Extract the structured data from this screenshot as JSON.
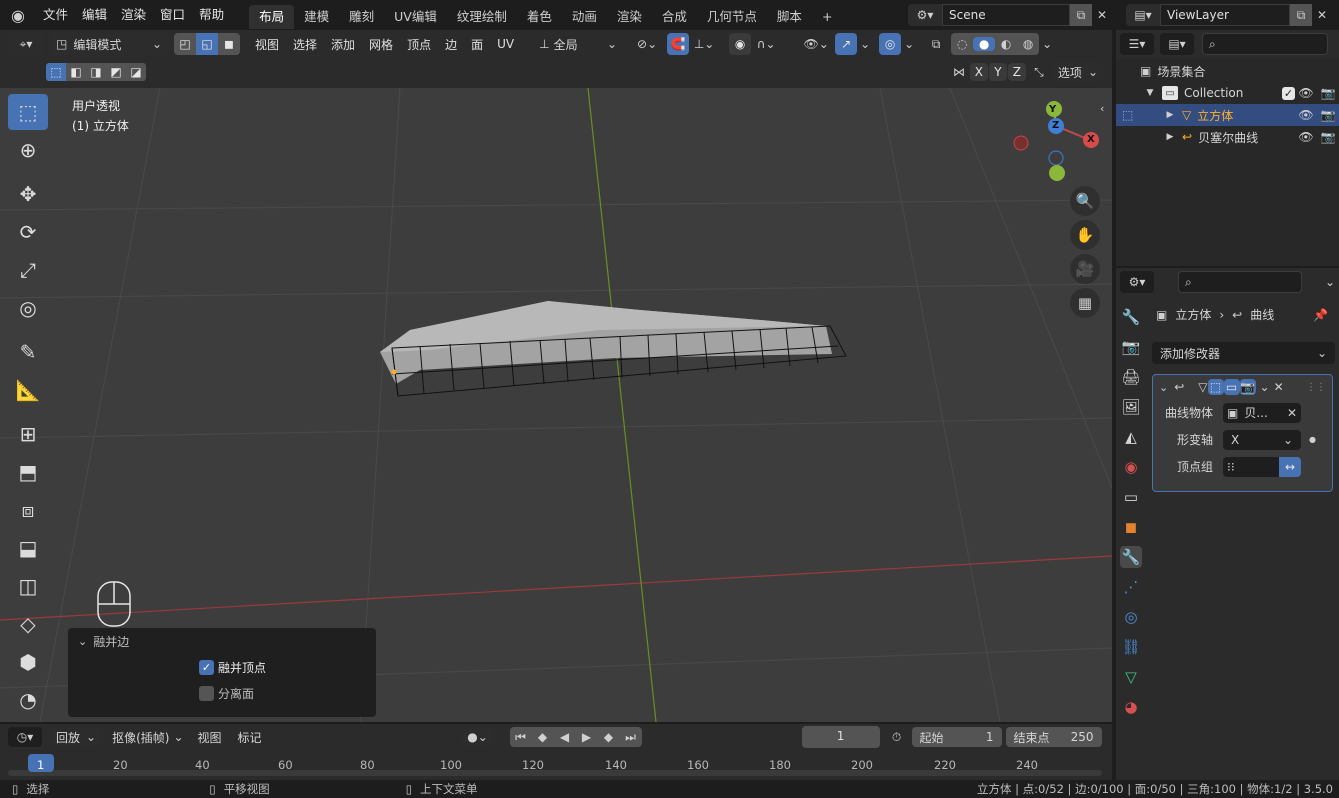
{
  "topbar": {
    "menus": [
      "文件",
      "编辑",
      "渲染",
      "窗口",
      "帮助"
    ],
    "workspaces": [
      "布局",
      "建模",
      "雕刻",
      "UV编辑",
      "纹理绘制",
      "着色",
      "动画",
      "渲染",
      "合成",
      "几何节点",
      "脚本"
    ],
    "active_workspace": "布局",
    "add_tab": "+",
    "scene": "Scene",
    "view_layer": "ViewLayer"
  },
  "viewport_header": {
    "mode": "编辑模式",
    "menus": [
      "视图",
      "选择",
      "添加",
      "网格",
      "顶点",
      "边",
      "面",
      "UV"
    ],
    "transform_orientation": "全局",
    "axes": [
      "X",
      "Y",
      "Z"
    ],
    "options": "选项"
  },
  "viewport": {
    "view_name": "用户透视",
    "object_label": "(1) 立方体",
    "gizmo_axes": {
      "x": "X",
      "y": "Y",
      "z": "Z"
    }
  },
  "operator_panel": {
    "title": "融并边",
    "option1": "融并顶点",
    "option1_checked": true,
    "option2": "分离面",
    "option2_checked": false
  },
  "outliner": {
    "root": "场景集合",
    "collection": "Collection",
    "items": [
      "立方体",
      "贝塞尔曲线"
    ]
  },
  "properties": {
    "breadcrumb_object": "立方体",
    "breadcrumb_modifier": "曲线",
    "add_modifier": "添加修改器",
    "curve_object_label": "曲线物体",
    "curve_object_value": "贝...",
    "deform_axis_label": "形变轴",
    "deform_axis_value": "X",
    "vertex_group_label": "顶点组"
  },
  "timeline": {
    "playback": "回放",
    "keying": "抠像(插帧)",
    "view": "视图",
    "marker": "标记",
    "current_frame": "1",
    "start_label": "起始",
    "start_value": "1",
    "end_label": "结束点",
    "end_value": "250",
    "ticks": [
      "1",
      "20",
      "40",
      "60",
      "80",
      "100",
      "120",
      "140",
      "160",
      "180",
      "200",
      "220",
      "240"
    ]
  },
  "statusbar": {
    "select": "选择",
    "pan": "平移视图",
    "context_menu": "上下文菜单",
    "stats": "立方体 | 点:0/52 | 边:0/100 | 面:0/50 | 三角:100 | 物体:1/2 | 3.5.0"
  },
  "colors": {
    "accent": "#4772b3",
    "active_object": "#ffaf29",
    "x_axis": "#c24a4a",
    "y_axis": "#8bb83a",
    "z_axis": "#3f7fd6"
  }
}
